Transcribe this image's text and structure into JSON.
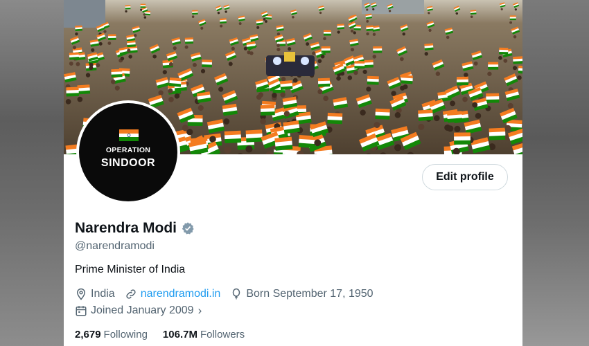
{
  "profile": {
    "name": "Narendra Modi",
    "handle": "@narendramodi",
    "bio": "Prime Minister of India",
    "location": "India",
    "website": "narendramodi.in",
    "birthday": "Born September 17, 1950",
    "joined": "Joined January 2009",
    "verified": true
  },
  "avatar": {
    "line1": "OPERATION",
    "line2": "SINDOOR"
  },
  "actions": {
    "edit_label": "Edit profile"
  },
  "stats": {
    "following_count": "2,679",
    "following_label": "Following",
    "followers_count": "106.7M",
    "followers_label": "Followers"
  },
  "colors": {
    "accent": "#1d9bf0",
    "verified": "#829aab",
    "saffron": "#f47c20",
    "green": "#138808"
  },
  "icons": {
    "location": "location-pin-icon",
    "website": "link-icon",
    "birthday": "balloon-icon",
    "joined": "calendar-icon",
    "verified": "verified-badge-icon",
    "chevron": "chevron-right-icon"
  }
}
